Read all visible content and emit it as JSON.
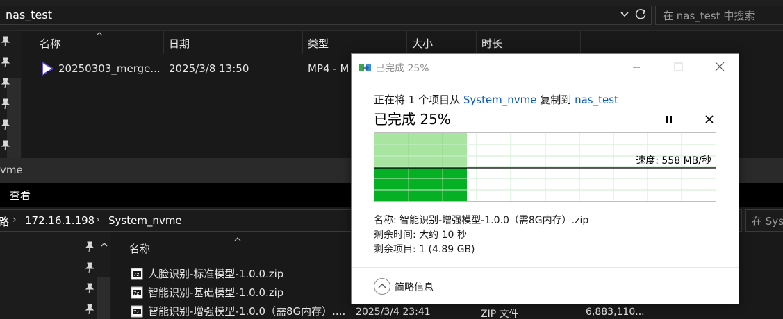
{
  "top_explorer": {
    "address": "nas_test",
    "search_placeholder": "在 nas_test 中搜索",
    "columns": [
      "名称",
      "日期",
      "类型",
      "大小",
      "时长"
    ],
    "row": {
      "name": "20250303_merge...",
      "date": "2025/3/8 13:50",
      "type": "MP4 - M"
    }
  },
  "status_band": {
    "text": "vme"
  },
  "ribbon": {
    "view_label": "查看"
  },
  "bottom_explorer": {
    "breadcrumb": [
      "路",
      "172.16.1.198",
      "System_nvme"
    ],
    "search_placeholder": "在 Syst",
    "name_column": "名称",
    "files": [
      {
        "name": "人脸识别-标准模型-1.0.0.zip"
      },
      {
        "name": "智能识别-基础模型-1.0.0.zip"
      },
      {
        "name": "智能识别-增强模型-1.0.0（需8G内存）....",
        "date": "2025/3/4 23:41",
        "type": "ZIP 文件",
        "size": "6,883,110..."
      }
    ]
  },
  "dialog": {
    "title": "已完成 25%",
    "line1_prefix": "正在将 1 个项目从 ",
    "source": "System_nvme",
    "line1_mid": " 复制到 ",
    "destination": "nas_test",
    "big_status": "已完成 25%",
    "progress_percent": 25,
    "speed_label": "速度: 558 MB/秒",
    "name_line": "名称: 智能识别-增强模型-1.0.0（需8G内存）.zip",
    "time_left_line": "剩余时间: 大约 10 秒",
    "items_left_line": "剩余项目: 1 (4.89 GB)",
    "less_info_label": "简略信息"
  },
  "colors": {
    "accent_link": "#0a5cbf",
    "progress_dark": "#06b025",
    "progress_light": "#a8e5a0",
    "dark_bg": "#191919"
  }
}
